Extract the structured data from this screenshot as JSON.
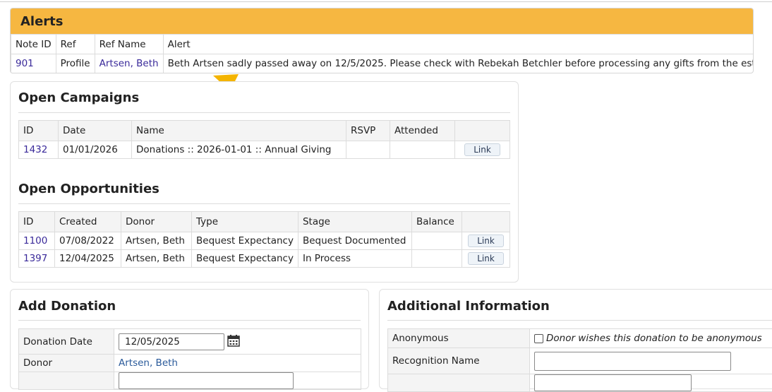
{
  "alerts": {
    "title": "Alerts",
    "columns": [
      "Note ID",
      "Ref",
      "Ref Name",
      "Alert"
    ],
    "rows": [
      {
        "note_id": "901",
        "ref": "Profile",
        "ref_name": "Artsen, Beth",
        "alert": "Beth Artsen sadly passed away on 12/5/2025. Please check with Rebekah Betchler before processing any gifts from the estate."
      }
    ]
  },
  "campaigns": {
    "title": "Open Campaigns",
    "columns": [
      "ID",
      "Date",
      "Name",
      "RSVP",
      "Attended",
      ""
    ],
    "rows": [
      {
        "id": "1432",
        "date": "01/01/2026",
        "name": "Donations :: 2026-01-01 :: Annual Giving",
        "rsvp": "",
        "attended": "",
        "link": "Link"
      }
    ]
  },
  "opportunities": {
    "title": "Open Opportunities",
    "columns": [
      "ID",
      "Created",
      "Donor",
      "Type",
      "Stage",
      "Balance",
      ""
    ],
    "rows": [
      {
        "id": "1100",
        "created": "07/08/2022",
        "donor": "Artsen, Beth",
        "type": "Bequest Expectancy",
        "stage": "Bequest Documented",
        "balance": "",
        "link": "Link"
      },
      {
        "id": "1397",
        "created": "12/04/2025",
        "donor": "Artsen, Beth",
        "type": "Bequest Expectancy",
        "stage": "In Process",
        "balance": "",
        "link": "Link"
      }
    ]
  },
  "add_donation": {
    "title": "Add Donation",
    "date_label": "Donation Date",
    "date_value": "12/05/2025",
    "donor_label": "Donor",
    "donor_value": "Artsen, Beth"
  },
  "additional": {
    "title": "Additional Information",
    "anonymous_label": "Anonymous",
    "anonymous_text": "Donor wishes this donation to be anonymous",
    "recognition_label": "Recognition Name",
    "recognition_value": ""
  },
  "colors": {
    "alerts_header": "#f6b741",
    "arrow": "#f4b400",
    "link": "#3a2a9a"
  },
  "icons": {
    "calendar": "calendar-icon",
    "arrow": "annotation-arrow"
  }
}
